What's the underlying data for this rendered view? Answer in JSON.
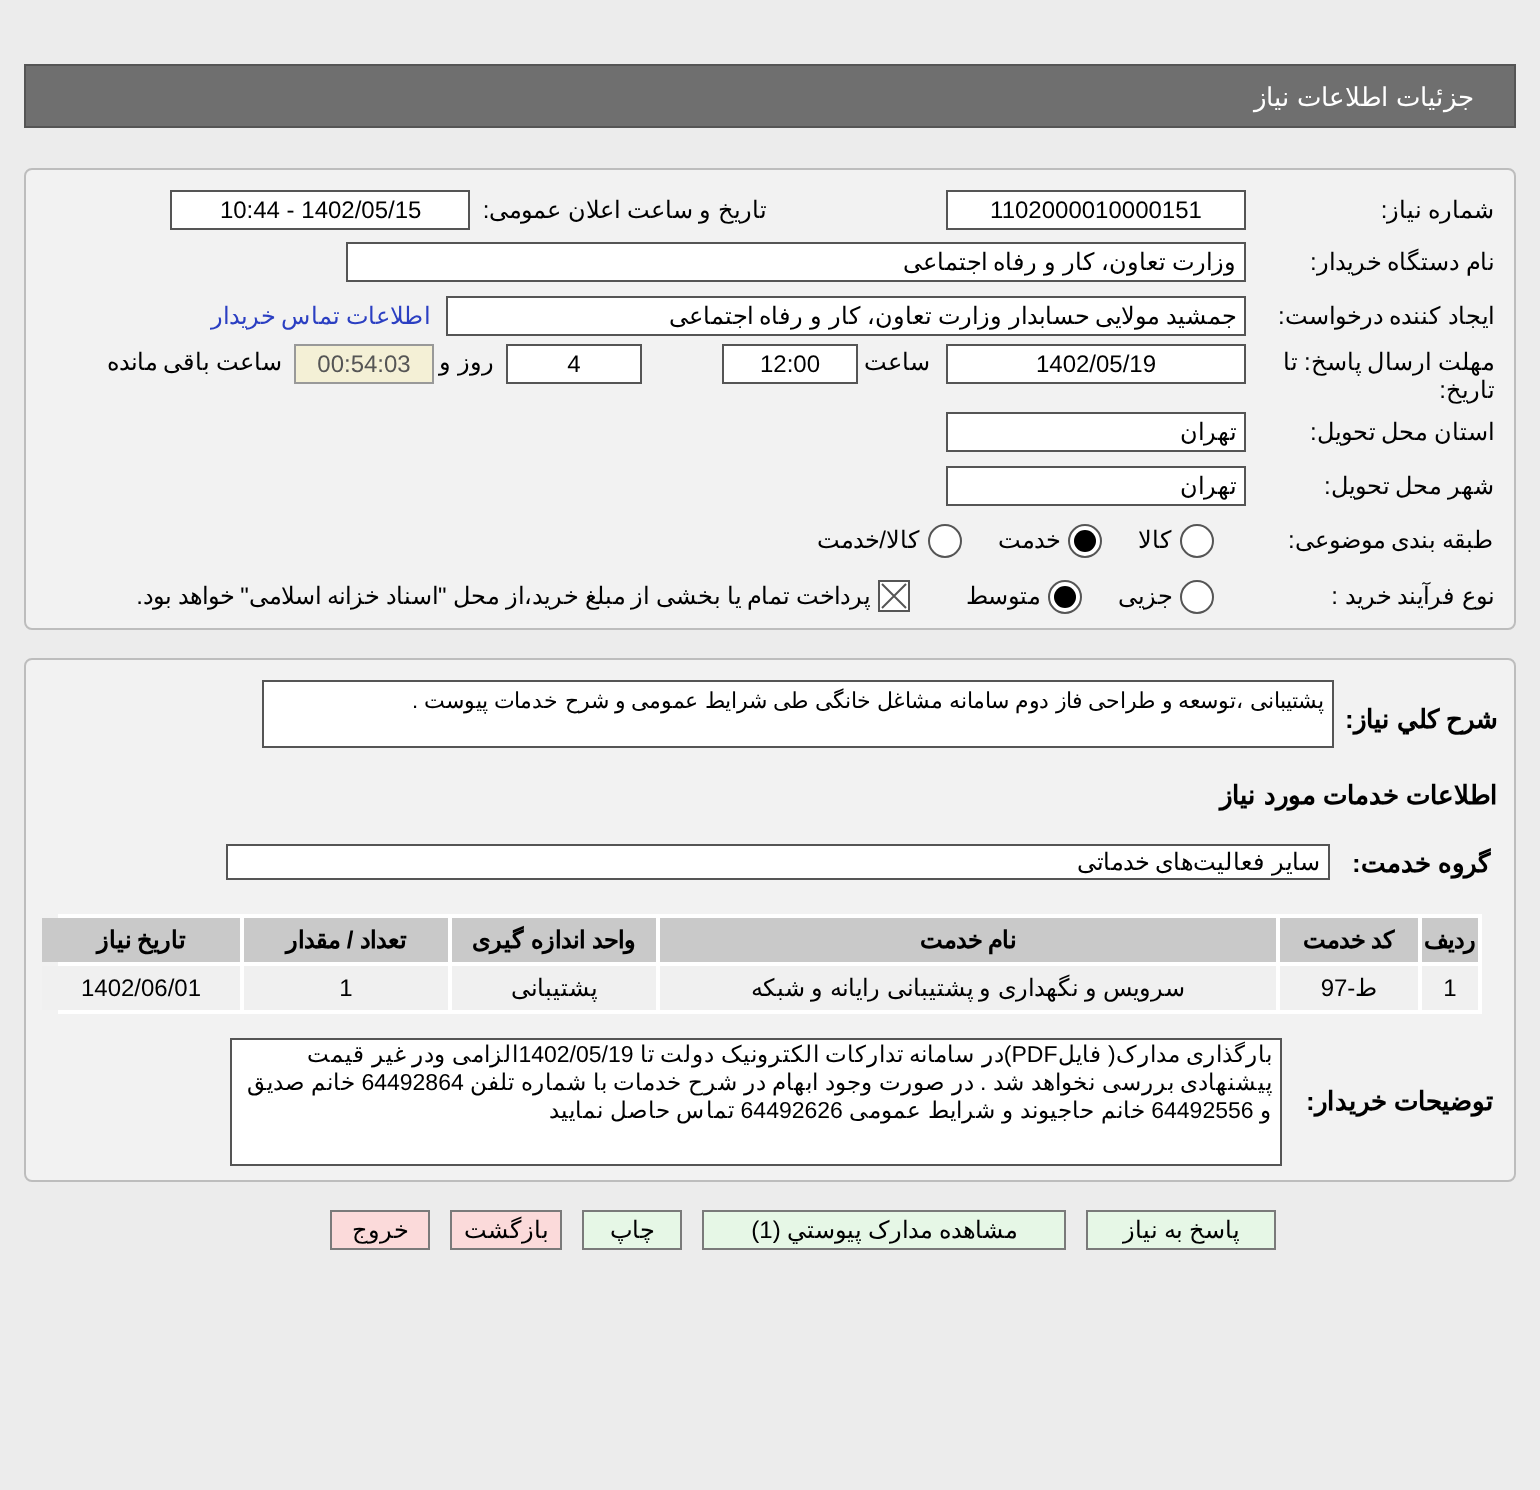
{
  "page_title": "جزئیات اطلاعات نیاز",
  "need_number": {
    "label": "شماره نیاز:",
    "value": "1102000010000151"
  },
  "announce": {
    "label": "تاریخ و ساعت اعلان عمومی:",
    "value": "1402/05/15 - 10:44"
  },
  "buyer_org": {
    "label": "نام دستگاه خریدار:",
    "value": "وزارت تعاون، کار و رفاه اجتماعی"
  },
  "requester": {
    "label": "ایجاد کننده درخواست:",
    "value": "جمشید مولایی حسابدار وزارت تعاون، کار و رفاه اجتماعی",
    "link": "اطلاعات تماس خریدار"
  },
  "deadline": {
    "label": "مهلت ارسال پاسخ: تا تاریخ:",
    "date": "1402/05/19",
    "time_label": "ساعت",
    "time": "12:00",
    "days": "4",
    "days_label": "روز و",
    "remaining": "00:54:03",
    "remaining_label": "ساعت باقی مانده"
  },
  "province": {
    "label": "استان محل تحویل:",
    "value": "تهران"
  },
  "city": {
    "label": "شهر محل تحویل:",
    "value": "تهران"
  },
  "category": {
    "label": "طبقه بندی موضوعی:",
    "options": [
      {
        "label": "کالا",
        "selected": false
      },
      {
        "label": "خدمت",
        "selected": true
      },
      {
        "label": "کالا/خدمت",
        "selected": false
      }
    ]
  },
  "purchase_type": {
    "label": "نوع فرآیند خرید :",
    "options": [
      {
        "label": "جزیی",
        "selected": false
      },
      {
        "label": "متوسط",
        "selected": true
      }
    ],
    "payment": {
      "checked": true,
      "label": "پرداخت تمام یا بخشی از مبلغ خرید،از محل \"اسناد خزانه اسلامی\" خواهد بود."
    }
  },
  "description": {
    "label": "شرح کلي نياز:",
    "value": "پشتیبانی ،توسعه و طراحی فاز دوم سامانه مشاغل خانگی طی شرایط عمومی و شرح خدمات پیوست ."
  },
  "services_heading": "اطلاعات خدمات مورد نیاز",
  "service_group": {
    "label": "گروه خدمت:",
    "value": "سایر فعالیت‌های خدماتی"
  },
  "table": {
    "columns": [
      "ردیف",
      "کد خدمت",
      "نام خدمت",
      "واحد اندازه گیری",
      "تعداد / مقدار",
      "تاریخ نیاز"
    ],
    "rows": [
      [
        "1",
        "ط-97",
        "سرویس و نگهداری و پشتیبانی رایانه و شبکه",
        "پشتیبانی",
        "1",
        "1402/06/01"
      ]
    ]
  },
  "buyer_notes": {
    "label": "توضیحات خریدار:",
    "value": "بارگذاری مدارک( فایلPDF)در سامانه تدارکات الکترونیک دولت تا 1402/05/19الزامی ودر غیر قیمت پیشنهادی بررسی نخواهد شد . در صورت وجود ابهام در شرح خدمات با شماره تلفن 64492864 خانم صدیق و 64492556 خانم حاجیوند و شرایط عمومی 64492626 تماس حاصل نمایید"
  },
  "buttons": [
    {
      "label": "پاسخ به نیاز",
      "kind": "primary"
    },
    {
      "label": "مشاهده مدارک پیوستي (1)",
      "kind": "primary"
    },
    {
      "label": "چاپ",
      "kind": "primary"
    },
    {
      "label": "بازگشت",
      "kind": "danger"
    },
    {
      "label": "خروج",
      "kind": "danger"
    }
  ]
}
